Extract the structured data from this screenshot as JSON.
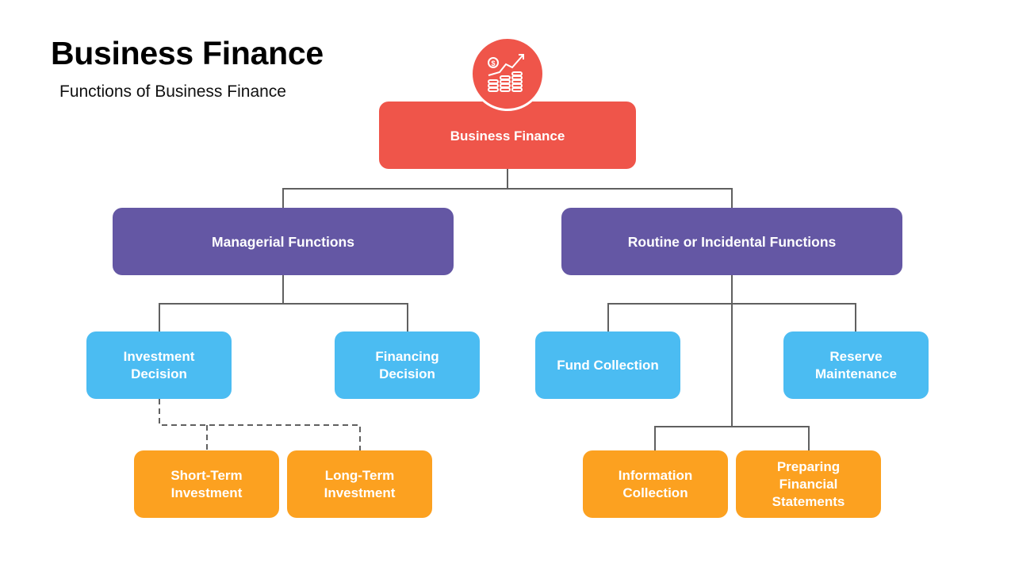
{
  "header": {
    "title": "Business Finance",
    "subtitle": "Functions of Business Finance"
  },
  "icon": {
    "name": "coins-growth-icon",
    "color": "#ef554a"
  },
  "colors": {
    "root": "#ef554a",
    "level1": "#6457a4",
    "level2": "#4bbcf2",
    "level3": "#fca120",
    "connector": "#606060"
  },
  "tree": {
    "root": "Business Finance",
    "managerial": {
      "label": "Managerial Functions",
      "investment": "Investment\nDecision",
      "financing": "Financing\nDecision",
      "short_term": "Short-Term\nInvestment",
      "long_term": "Long-Term\nInvestment"
    },
    "routine": {
      "label": "Routine or Incidental Functions",
      "fund_collection": "Fund Collection",
      "reserve": "Reserve\nMaintenance",
      "information": "Information\nCollection",
      "statements": "Preparing\nFinancial\nStatements"
    }
  }
}
